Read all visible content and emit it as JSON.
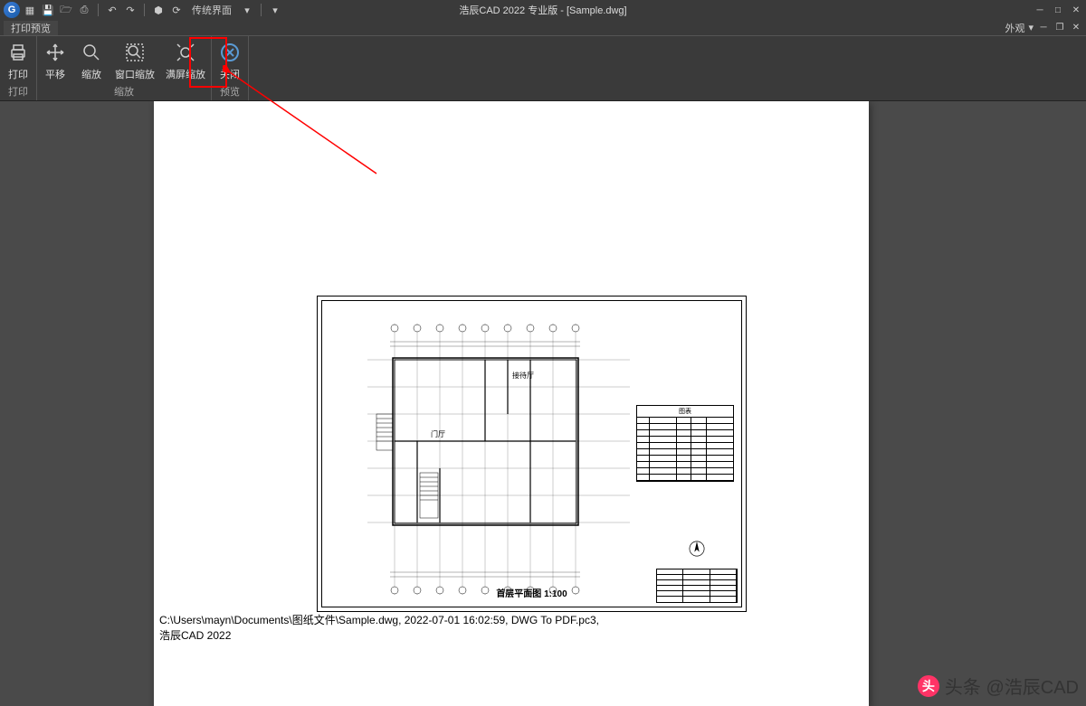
{
  "app": {
    "title": "浩辰CAD 2022 专业版 - [Sample.dwg]",
    "qat_style": "传统界面"
  },
  "tabs": {
    "active": "打印预览",
    "appearance_label": "外观"
  },
  "ribbon": {
    "print": {
      "label": "打印",
      "group": "打印"
    },
    "pan": {
      "label": "平移"
    },
    "zoom": {
      "label": "缩放"
    },
    "zoom_window": {
      "label": "窗口缩放"
    },
    "zoom_fit": {
      "label": "满屏缩放"
    },
    "zoom_group": "缩放",
    "close": {
      "label": "关闭"
    },
    "preview_group": "预览"
  },
  "drawing": {
    "title": "首层平面图   1:100",
    "room1": "接待厅",
    "room2": "门厅",
    "legend_title": "图表"
  },
  "footer": {
    "line1": "C:\\Users\\mayn\\Documents\\图纸文件\\Sample.dwg, 2022-07-01 16:02:59, DWG To PDF.pc3,",
    "line2": "浩辰CAD 2022"
  },
  "watermark": {
    "text": "头条 @浩辰CAD"
  }
}
